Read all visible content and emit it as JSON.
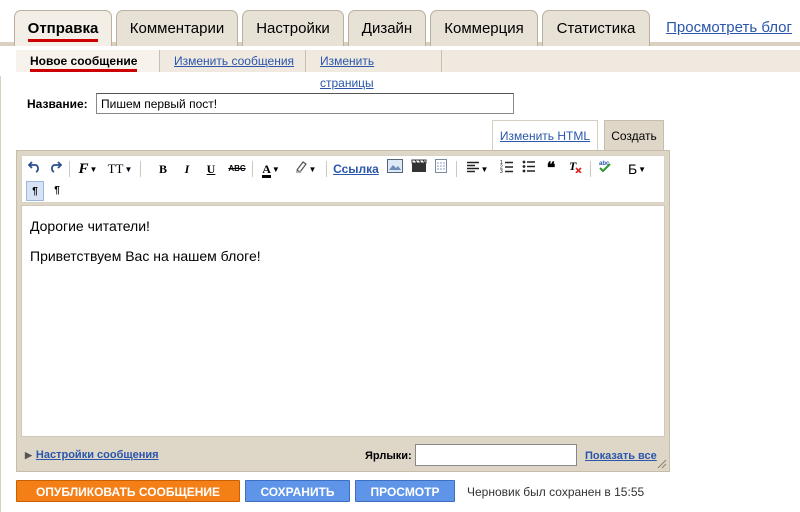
{
  "tabs": [
    {
      "label": "Отправка",
      "active": true
    },
    {
      "label": "Комментарии"
    },
    {
      "label": "Настройки"
    },
    {
      "label": "Дизайн"
    },
    {
      "label": "Коммерция"
    },
    {
      "label": "Статистика"
    }
  ],
  "view_blog": "Просмотреть блог",
  "subtabs": [
    {
      "label": "Новое сообщение",
      "active": true
    },
    {
      "label": "Изменить сообщения"
    },
    {
      "label": "Изменить страницы"
    }
  ],
  "title": {
    "label": "Название:",
    "value": "Пишем первый пост!"
  },
  "modes": {
    "html": "Изменить HTML",
    "compose": "Создать"
  },
  "toolbar": {
    "link": "Ссылка",
    "font_icon": "F",
    "size_icon": "TT",
    "bold": "B",
    "italic": "I",
    "underline": "U",
    "strike": "ABC",
    "text_color": "A",
    "lang": "Б",
    "ltr": "¶",
    "rtl": "¶"
  },
  "body": {
    "paragraphs": [
      "Дорогие читатели!",
      "Приветствуем Вас на нашем блоге!"
    ]
  },
  "footer": {
    "post_settings": "Настройки сообщения",
    "labels_label": "Ярлыки:",
    "labels_value": "",
    "show_all": "Показать все"
  },
  "buttons": {
    "publish": "ОПУБЛИКОВАТЬ СООБЩЕНИЕ",
    "save": "СОХРАНИТЬ",
    "preview": "ПРОСМОТР"
  },
  "draft_status": "Черновик был сохранен в 15:55",
  "colors": {
    "accent_red": "#cc0000",
    "publish": "#f57f17",
    "action_blue": "#5f95e8",
    "link": "#2a56ab"
  }
}
